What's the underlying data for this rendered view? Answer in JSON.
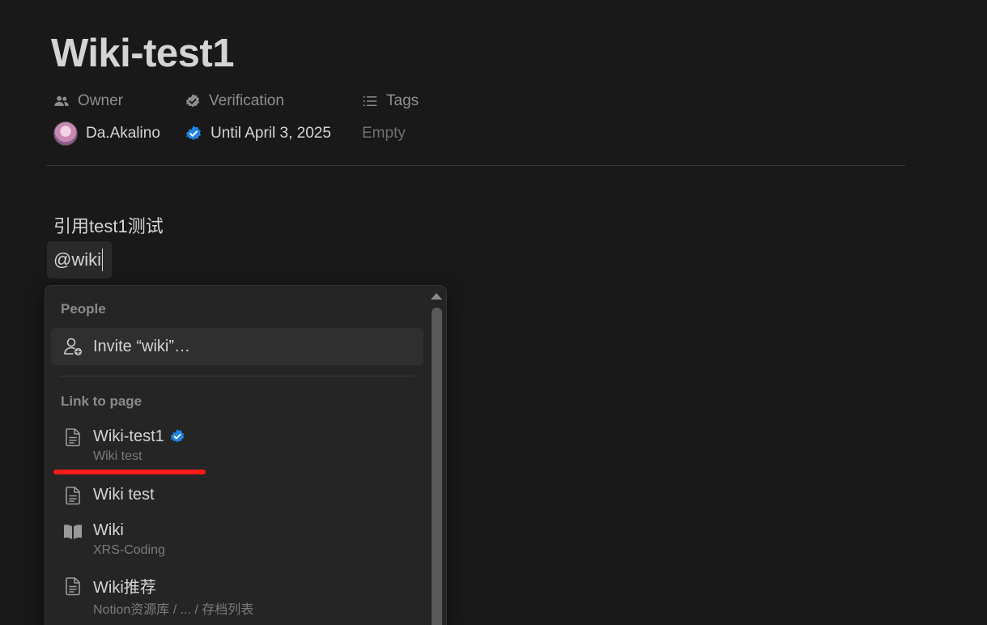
{
  "page": {
    "title": "Wiki-test1"
  },
  "properties": {
    "owner": {
      "label": "Owner",
      "icon": "people-icon",
      "value": "Da.Akalino"
    },
    "verification": {
      "label": "Verification",
      "icon": "verified-badge-icon",
      "value": "Until April 3, 2025"
    },
    "tags": {
      "label": "Tags",
      "icon": "list-icon",
      "value": "Empty"
    }
  },
  "body": {
    "text": "引用test1测试",
    "mention_input": "@wiki"
  },
  "menu": {
    "people_label": "People",
    "invite": "Invite “wiki”…",
    "link_label": "Link to page",
    "items": [
      {
        "title": "Wiki-test1",
        "subtitle": "Wiki test",
        "icon": "page-icon",
        "verified": true
      },
      {
        "title": "Wiki test",
        "subtitle": "",
        "icon": "page-icon",
        "verified": false
      },
      {
        "title": "Wiki",
        "subtitle": "XRS-Coding",
        "icon": "book-icon",
        "verified": false
      },
      {
        "title": "Wiki推荐",
        "subtitle": "Notion资源库 / ... / 存档列表",
        "icon": "page-icon",
        "verified": false
      }
    ]
  },
  "colors": {
    "background": "#191919",
    "verified_blue": "#2383e2",
    "highlight_red": "#ff1a1a"
  }
}
